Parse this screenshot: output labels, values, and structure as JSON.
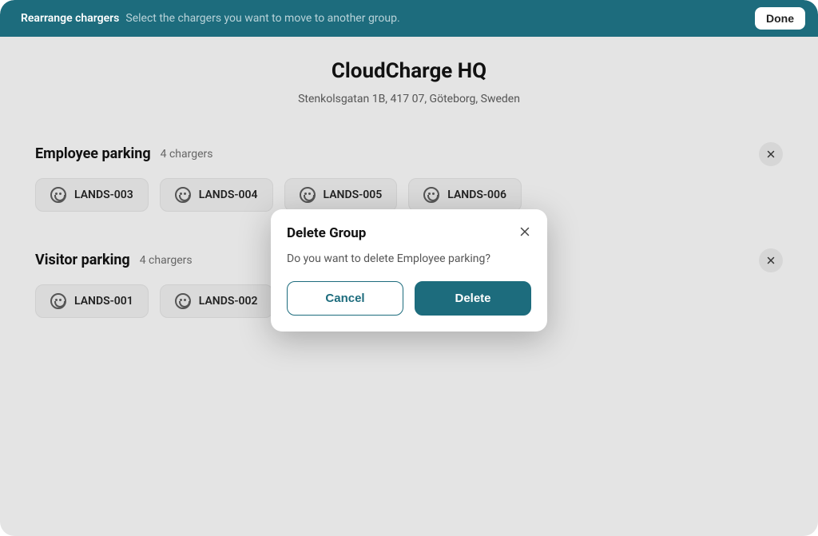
{
  "topbar": {
    "title": "Rearrange chargers",
    "subtitle": "Select the chargers you want to move to another group.",
    "done_label": "Done"
  },
  "site": {
    "name": "CloudCharge HQ",
    "address": "Stenkolsgatan 1B, 417 07, Göteborg, Sweden"
  },
  "groups": [
    {
      "name": "Employee parking",
      "count_label": "4 chargers",
      "chargers": [
        {
          "label": "LANDS-003"
        },
        {
          "label": "LANDS-004"
        },
        {
          "label": "LANDS-005"
        },
        {
          "label": "LANDS-006"
        }
      ]
    },
    {
      "name": "Visitor parking",
      "count_label": "4 chargers",
      "chargers": [
        {
          "label": "LANDS-001"
        },
        {
          "label": "LANDS-002"
        }
      ]
    }
  ],
  "modal": {
    "title": "Delete Group",
    "body": "Do you want to delete Employee parking?",
    "cancel_label": "Cancel",
    "delete_label": "Delete"
  },
  "colors": {
    "primary": "#1d6c7d",
    "background": "#e4e4e4",
    "chip": "#dadada"
  }
}
